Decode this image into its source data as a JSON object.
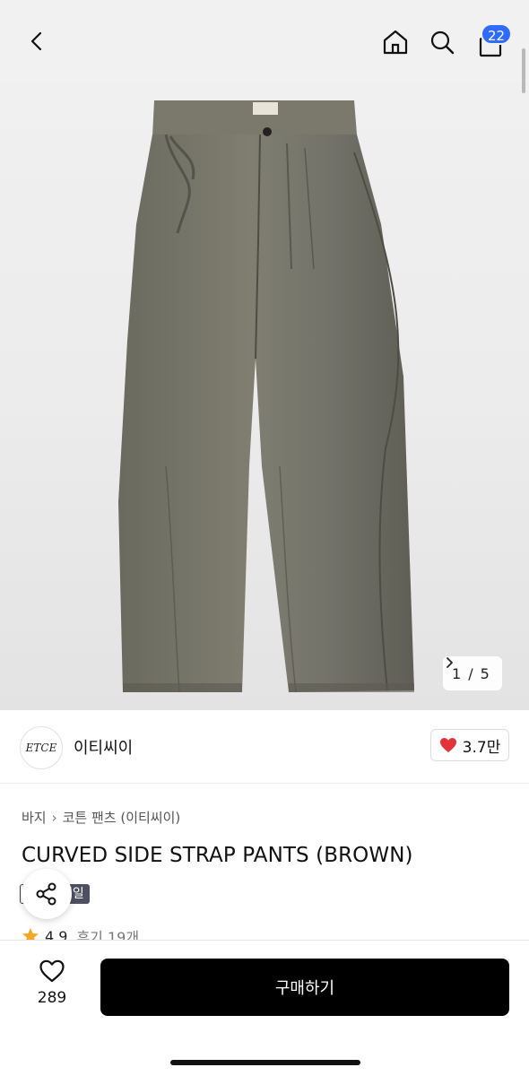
{
  "header": {
    "back_icon": "chevron-left-icon",
    "home_icon": "home-icon",
    "search_icon": "search-icon",
    "cart_icon": "shopping-bag-icon",
    "cart_count": "22"
  },
  "gallery": {
    "current": "1",
    "separator": "/",
    "total": "5",
    "next_icon": "chevron-right-icon"
  },
  "brand": {
    "logo_text": "ETCE",
    "name": "이티씨이",
    "like_icon": "heart-icon",
    "like_count": "3.7만"
  },
  "breadcrumb": {
    "items": [
      "바지",
      "코튼 팬츠 (이티씨이)"
    ]
  },
  "product": {
    "title": "CURVED SIDE STRAP PANTS (BROWN)",
    "sale_tag": "세일"
  },
  "share": {
    "icon": "share-icon"
  },
  "rating": {
    "icon": "star-icon",
    "score": "4.9",
    "reviews": "후기 19개"
  },
  "bottom": {
    "wish_icon": "heart-outline-icon",
    "wish_count": "289",
    "buy_label": "구매하기"
  },
  "colors": {
    "badge": "#2f6bff",
    "heart": "#e3333a",
    "star": "#f5a623",
    "buy_button": "#000000",
    "sale_tag": "#4f4f62"
  }
}
